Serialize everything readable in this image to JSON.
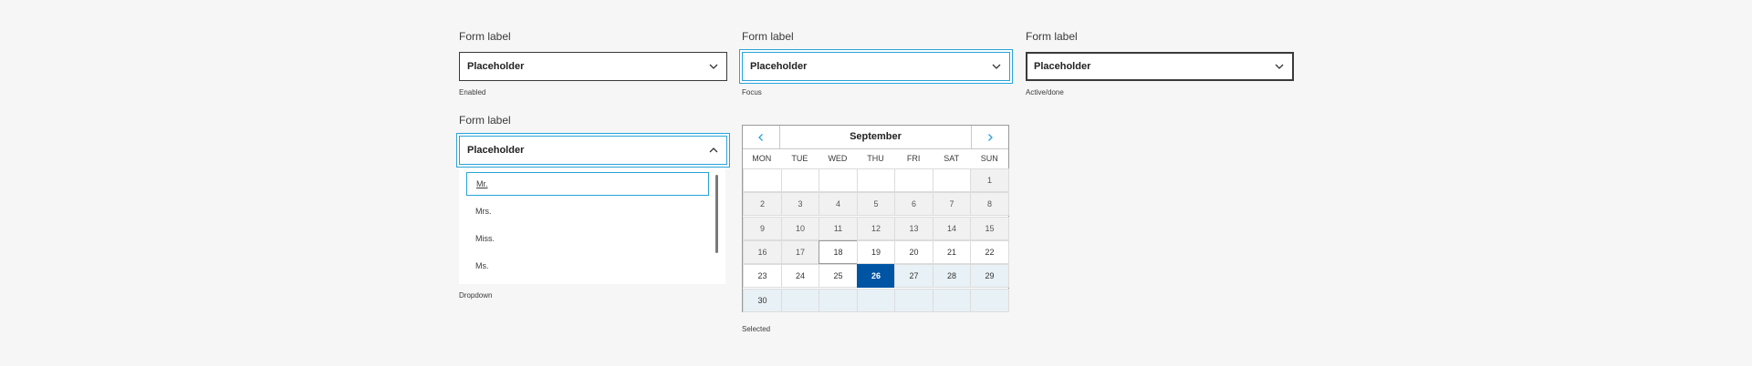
{
  "fields": {
    "enabled": {
      "label": "Form label",
      "placeholder": "Placeholder",
      "caption": "Enabled"
    },
    "focus": {
      "label": "Form label",
      "placeholder": "Placeholder",
      "caption": "Focus"
    },
    "active": {
      "label": "Form label",
      "placeholder": "Placeholder",
      "caption": "Active/done"
    },
    "dropdown": {
      "label": "Form label",
      "placeholder": "Placeholder",
      "caption": "Dropdown",
      "options": [
        "Mr.",
        "Mrs.",
        "Miss.",
        "Ms."
      ],
      "highlighted": "Mr."
    }
  },
  "calendar": {
    "month": "September",
    "caption": "Selected",
    "weekdays": [
      "MON",
      "TUE",
      "WED",
      "THU",
      "FRI",
      "SAT",
      "SUN"
    ],
    "days": [
      "1",
      "2",
      "3",
      "4",
      "5",
      "6",
      "7",
      "8",
      "9",
      "10",
      "11",
      "12",
      "13",
      "14",
      "15",
      "16",
      "17",
      "18",
      "19",
      "20",
      "21",
      "22",
      "23",
      "24",
      "25",
      "26",
      "27",
      "28",
      "29",
      "30"
    ],
    "first_weekday_index": 6,
    "today": "18",
    "selected": "26",
    "icons": {
      "prev": "chevron-left-icon",
      "next": "chevron-right-icon"
    },
    "accent": "#0054a4"
  },
  "colors": {
    "focus_ring": "#28a3d8",
    "selected_day": "#0054a4",
    "range": "#e8f1f6"
  }
}
